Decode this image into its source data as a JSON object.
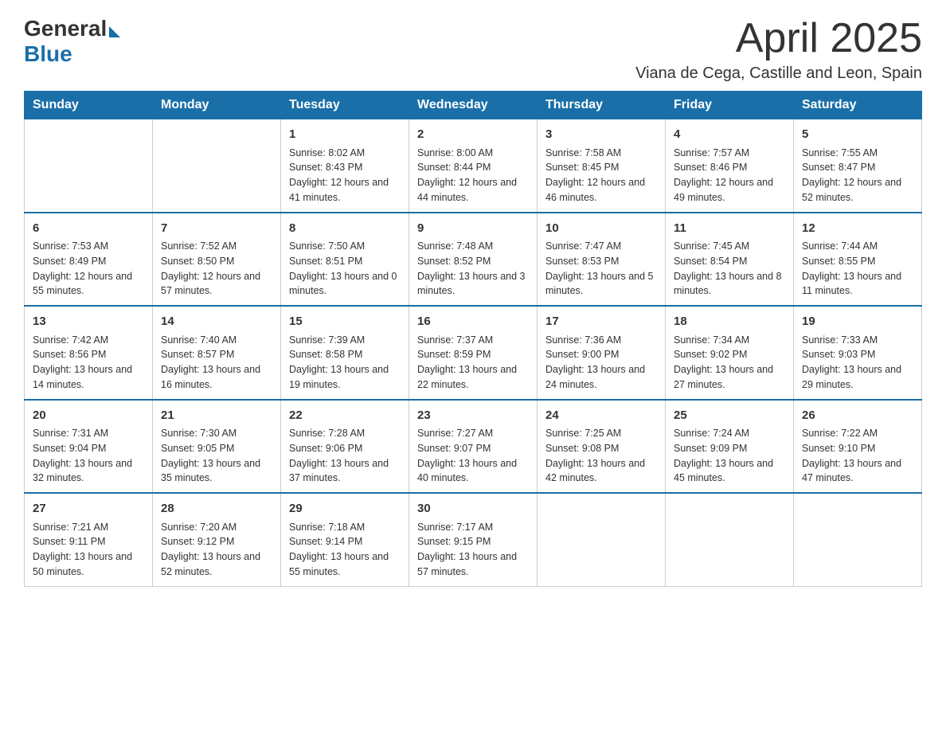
{
  "logo": {
    "general": "General",
    "blue": "Blue"
  },
  "header": {
    "month": "April 2025",
    "location": "Viana de Cega, Castille and Leon, Spain"
  },
  "days_of_week": [
    "Sunday",
    "Monday",
    "Tuesday",
    "Wednesday",
    "Thursday",
    "Friday",
    "Saturday"
  ],
  "weeks": [
    [
      {
        "day": "",
        "sunrise": "",
        "sunset": "",
        "daylight": ""
      },
      {
        "day": "",
        "sunrise": "",
        "sunset": "",
        "daylight": ""
      },
      {
        "day": "1",
        "sunrise": "Sunrise: 8:02 AM",
        "sunset": "Sunset: 8:43 PM",
        "daylight": "Daylight: 12 hours and 41 minutes."
      },
      {
        "day": "2",
        "sunrise": "Sunrise: 8:00 AM",
        "sunset": "Sunset: 8:44 PM",
        "daylight": "Daylight: 12 hours and 44 minutes."
      },
      {
        "day": "3",
        "sunrise": "Sunrise: 7:58 AM",
        "sunset": "Sunset: 8:45 PM",
        "daylight": "Daylight: 12 hours and 46 minutes."
      },
      {
        "day": "4",
        "sunrise": "Sunrise: 7:57 AM",
        "sunset": "Sunset: 8:46 PM",
        "daylight": "Daylight: 12 hours and 49 minutes."
      },
      {
        "day": "5",
        "sunrise": "Sunrise: 7:55 AM",
        "sunset": "Sunset: 8:47 PM",
        "daylight": "Daylight: 12 hours and 52 minutes."
      }
    ],
    [
      {
        "day": "6",
        "sunrise": "Sunrise: 7:53 AM",
        "sunset": "Sunset: 8:49 PM",
        "daylight": "Daylight: 12 hours and 55 minutes."
      },
      {
        "day": "7",
        "sunrise": "Sunrise: 7:52 AM",
        "sunset": "Sunset: 8:50 PM",
        "daylight": "Daylight: 12 hours and 57 minutes."
      },
      {
        "day": "8",
        "sunrise": "Sunrise: 7:50 AM",
        "sunset": "Sunset: 8:51 PM",
        "daylight": "Daylight: 13 hours and 0 minutes."
      },
      {
        "day": "9",
        "sunrise": "Sunrise: 7:48 AM",
        "sunset": "Sunset: 8:52 PM",
        "daylight": "Daylight: 13 hours and 3 minutes."
      },
      {
        "day": "10",
        "sunrise": "Sunrise: 7:47 AM",
        "sunset": "Sunset: 8:53 PM",
        "daylight": "Daylight: 13 hours and 5 minutes."
      },
      {
        "day": "11",
        "sunrise": "Sunrise: 7:45 AM",
        "sunset": "Sunset: 8:54 PM",
        "daylight": "Daylight: 13 hours and 8 minutes."
      },
      {
        "day": "12",
        "sunrise": "Sunrise: 7:44 AM",
        "sunset": "Sunset: 8:55 PM",
        "daylight": "Daylight: 13 hours and 11 minutes."
      }
    ],
    [
      {
        "day": "13",
        "sunrise": "Sunrise: 7:42 AM",
        "sunset": "Sunset: 8:56 PM",
        "daylight": "Daylight: 13 hours and 14 minutes."
      },
      {
        "day": "14",
        "sunrise": "Sunrise: 7:40 AM",
        "sunset": "Sunset: 8:57 PM",
        "daylight": "Daylight: 13 hours and 16 minutes."
      },
      {
        "day": "15",
        "sunrise": "Sunrise: 7:39 AM",
        "sunset": "Sunset: 8:58 PM",
        "daylight": "Daylight: 13 hours and 19 minutes."
      },
      {
        "day": "16",
        "sunrise": "Sunrise: 7:37 AM",
        "sunset": "Sunset: 8:59 PM",
        "daylight": "Daylight: 13 hours and 22 minutes."
      },
      {
        "day": "17",
        "sunrise": "Sunrise: 7:36 AM",
        "sunset": "Sunset: 9:00 PM",
        "daylight": "Daylight: 13 hours and 24 minutes."
      },
      {
        "day": "18",
        "sunrise": "Sunrise: 7:34 AM",
        "sunset": "Sunset: 9:02 PM",
        "daylight": "Daylight: 13 hours and 27 minutes."
      },
      {
        "day": "19",
        "sunrise": "Sunrise: 7:33 AM",
        "sunset": "Sunset: 9:03 PM",
        "daylight": "Daylight: 13 hours and 29 minutes."
      }
    ],
    [
      {
        "day": "20",
        "sunrise": "Sunrise: 7:31 AM",
        "sunset": "Sunset: 9:04 PM",
        "daylight": "Daylight: 13 hours and 32 minutes."
      },
      {
        "day": "21",
        "sunrise": "Sunrise: 7:30 AM",
        "sunset": "Sunset: 9:05 PM",
        "daylight": "Daylight: 13 hours and 35 minutes."
      },
      {
        "day": "22",
        "sunrise": "Sunrise: 7:28 AM",
        "sunset": "Sunset: 9:06 PM",
        "daylight": "Daylight: 13 hours and 37 minutes."
      },
      {
        "day": "23",
        "sunrise": "Sunrise: 7:27 AM",
        "sunset": "Sunset: 9:07 PM",
        "daylight": "Daylight: 13 hours and 40 minutes."
      },
      {
        "day": "24",
        "sunrise": "Sunrise: 7:25 AM",
        "sunset": "Sunset: 9:08 PM",
        "daylight": "Daylight: 13 hours and 42 minutes."
      },
      {
        "day": "25",
        "sunrise": "Sunrise: 7:24 AM",
        "sunset": "Sunset: 9:09 PM",
        "daylight": "Daylight: 13 hours and 45 minutes."
      },
      {
        "day": "26",
        "sunrise": "Sunrise: 7:22 AM",
        "sunset": "Sunset: 9:10 PM",
        "daylight": "Daylight: 13 hours and 47 minutes."
      }
    ],
    [
      {
        "day": "27",
        "sunrise": "Sunrise: 7:21 AM",
        "sunset": "Sunset: 9:11 PM",
        "daylight": "Daylight: 13 hours and 50 minutes."
      },
      {
        "day": "28",
        "sunrise": "Sunrise: 7:20 AM",
        "sunset": "Sunset: 9:12 PM",
        "daylight": "Daylight: 13 hours and 52 minutes."
      },
      {
        "day": "29",
        "sunrise": "Sunrise: 7:18 AM",
        "sunset": "Sunset: 9:14 PM",
        "daylight": "Daylight: 13 hours and 55 minutes."
      },
      {
        "day": "30",
        "sunrise": "Sunrise: 7:17 AM",
        "sunset": "Sunset: 9:15 PM",
        "daylight": "Daylight: 13 hours and 57 minutes."
      },
      {
        "day": "",
        "sunrise": "",
        "sunset": "",
        "daylight": ""
      },
      {
        "day": "",
        "sunrise": "",
        "sunset": "",
        "daylight": ""
      },
      {
        "day": "",
        "sunrise": "",
        "sunset": "",
        "daylight": ""
      }
    ]
  ]
}
